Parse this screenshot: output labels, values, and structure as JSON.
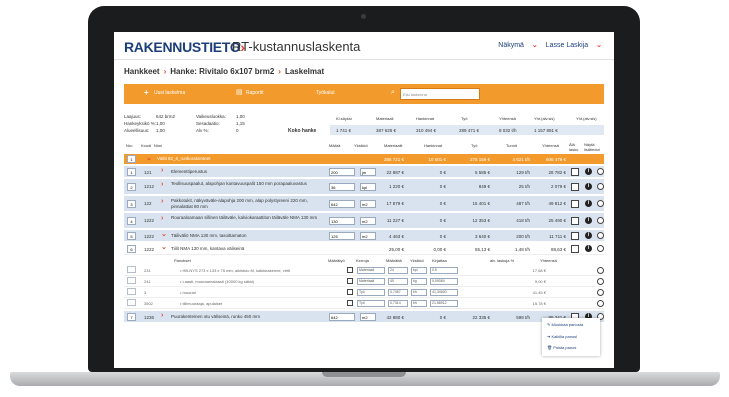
{
  "app": {
    "logo_main": "RAKENNUSTIETO",
    "logo_arrow": "›",
    "title": "RT-kustannuslaskenta"
  },
  "topnav": {
    "view_label": "Näkymä",
    "user_label": "Lasse Laskija",
    "chevron": "⌄"
  },
  "breadcrumb": {
    "items": [
      "Hankkeet",
      "Hanke: Rivitalo 6x107 brm2",
      "Laskelmat"
    ],
    "separator": "›"
  },
  "toolbar": {
    "new_label": "Uusi laskelma",
    "export_label": "Raportit",
    "tools_label": "Työkalut",
    "search_placeholder": "Etsi laskenna"
  },
  "info": {
    "labels": [
      "Laajuus:",
      "Hankeyksikö %:",
      "Alueellisuus:",
      "Vaikeusluokka:",
      "Sesadaatio:",
      "Alv %:"
    ],
    "values": [
      "642 brm2",
      "1,00",
      "1,00",
      "1,00",
      "1,15",
      "0"
    ]
  },
  "summary": {
    "label": "Koko hanke",
    "headers": [
      "Kl.säyksi",
      "Materiaali",
      "Hankinnat",
      "Työ",
      "Yhteensä",
      "Yht.(alv.sis)",
      "Yht.(alv.sis)"
    ],
    "values": [
      "1 741 €",
      "387 625 €",
      "310 494 €",
      "289 471 €",
      "8 032 t/h",
      "1 157 891 €",
      ""
    ]
  },
  "columns": [
    "Nro",
    "Koodi",
    "Nimi",
    "Määrä",
    "Yksikkö",
    "Materiaalit",
    "Hankinnat",
    "Työ",
    "Tunnit",
    "Yhteensä",
    "Älä lasko",
    "Näytä lisätiedot"
  ],
  "orange_row": {
    "num": "1",
    "name": "Väliti 82_6_runkorakenteet",
    "values": [
      "386 721 €",
      "10 601 €",
      "278 156 €",
      "4 621 t/h",
      "606 479 €"
    ]
  },
  "rows": [
    {
      "num": "1",
      "code": "121",
      "name": "Elementtiperustus",
      "qty": "200",
      "unit": "jm",
      "values": [
        "22 887 €",
        "0 €",
        "5 585 €",
        "129 t/h",
        "28 782 €"
      ]
    },
    {
      "num": "2",
      "code": "1212",
      "name": "Teollisuuspaalut, alapohjan kantavuuspalit 150 mm porapaaluvastus",
      "qty": "36",
      "unit": "kpl",
      "values": [
        "1 220 €",
        "0 €",
        "849 €",
        "25 t/h",
        "2 079 €"
      ]
    },
    {
      "num": "3",
      "code": "122",
      "name": "Pakkotukit, näkyväväle-alapohja 200 mm, alap polystyreeni 220 mm, pinnalattiat 80 mm",
      "qty": "642",
      "unit": "m2",
      "values": [
        "17 879 €",
        "0 €",
        "15 401 €",
        "487 t/h",
        "49 812 €"
      ]
    },
    {
      "num": "4",
      "code": "1222",
      "name": "Rouraaloamaan sillinen täiläväle, kalviokaraattiton täiläväle NMA 130 mm",
      "qty": "130",
      "unit": "m2",
      "values": [
        "11 227 €",
        "0 €",
        "12 353 €",
        "418 t/h",
        "25 490 €"
      ]
    },
    {
      "num": "5",
      "code": "1222",
      "name": "Täiliväliö NMA 130 mm, tasoittamaton",
      "qty": "125",
      "unit": "m2",
      "values": [
        "4 463 €",
        "0 €",
        "3 640 €",
        "200 t/h",
        "11 711 €"
      ]
    }
  ],
  "plain_row": {
    "num": "6",
    "code": "1222",
    "name": "Tiilit NMA 130 mm, kantava väliseinä",
    "values": [
      "25,00 €",
      "0,00 €",
      "55,13 €",
      "1,48 t/h",
      "88,63 €"
    ]
  },
  "sub_headers": [
    "Panokset",
    "Määrätyö",
    "Kerroja",
    "Määrättä",
    "Yksikkö",
    "Kirjattaa",
    "alv. laskuja %",
    "Yhteensä"
  ],
  "sub_rows": [
    {
      "code": "231",
      "name": "• HB-NYS 273 x 133 x 75 mm, aikistuio M, kalkkirakenne, virtti",
      "sel": "Materiaali",
      "f1": "24",
      "f2": "kpl",
      "f3": "0.5",
      "total": "17,68 €"
    },
    {
      "code": "241",
      "name": "• Laasti, muuraamalaasti (10000 kg säkki)",
      "sel": "Materiaali",
      "f1": "40",
      "f2": "kg",
      "f3": "0,09084",
      "total": "9,00 €"
    },
    {
      "code": "3",
      "name": "• muurari",
      "sel": "Työ",
      "f1": "0,7457",
      "f2": "t/h",
      "f3": "41,34600",
      "total": "41,45 €"
    },
    {
      "code": "3502",
      "name": "• tiilimuuraaja, apulaiset",
      "sel": "Työ",
      "f1": "0,7314",
      "f2": "t/h",
      "f3": "21,58912",
      "total": "15,78 €"
    }
  ],
  "last_row": {
    "num": "7",
    "code": "1236",
    "name": "Puurakenteinen otu väliseinä, runko 450 mm",
    "qty": "642",
    "unit": "m2",
    "values": [
      "42 880 €",
      "0 €",
      "22 335 €",
      "599 t/h",
      "85 241 €"
    ]
  },
  "popup": {
    "items": [
      "Muokkaa panosta",
      "Kaikilla panosl",
      "Poista panos"
    ]
  }
}
